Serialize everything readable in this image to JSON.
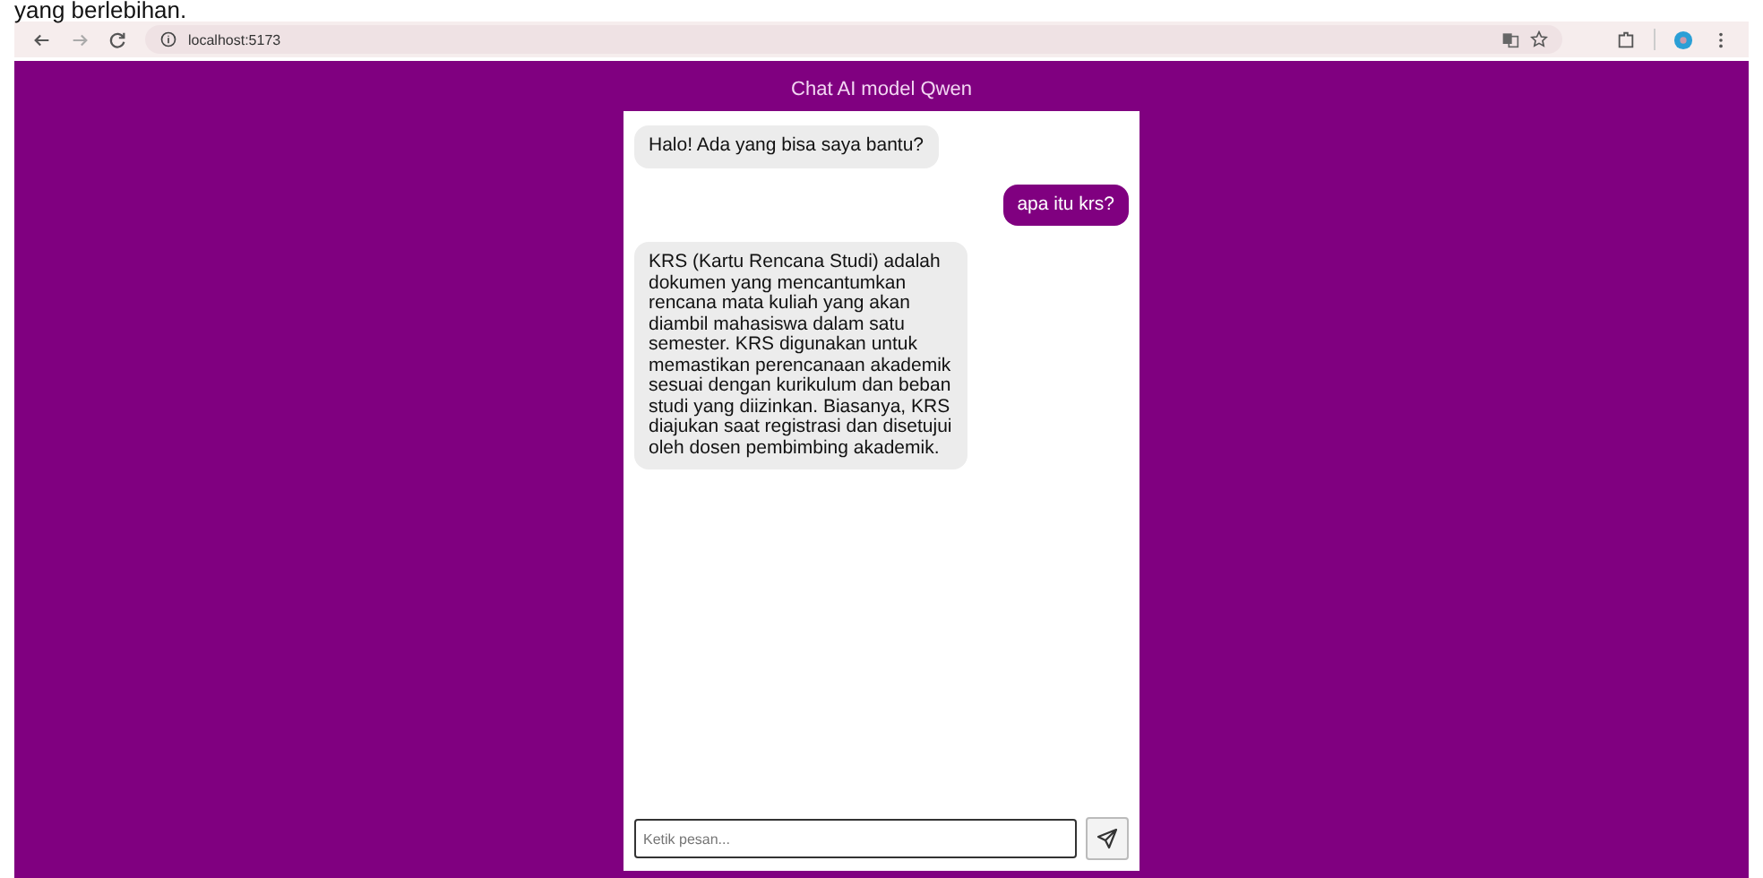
{
  "caption": "yang berlebihan.",
  "browser": {
    "url": "localhost:5173"
  },
  "chat": {
    "title": "Chat AI model Qwen",
    "messages": [
      {
        "kind": "bot",
        "text": "Halo! Ada yang bisa saya bantu?"
      },
      {
        "kind": "user",
        "text": "apa itu krs?"
      },
      {
        "kind": "bot",
        "text": "KRS (Kartu Rencana Studi) adalah dokumen yang mencantumkan rencana mata kuliah yang akan diambil mahasiswa dalam satu semester. KRS digunakan untuk memastikan perencanaan akademik sesuai dengan kurikulum dan beban studi yang diizinkan. Biasanya, KRS diajukan saat registrasi dan disetujui oleh dosen pembimbing akademik."
      }
    ],
    "input": {
      "placeholder": "Ketik pesan..."
    }
  }
}
